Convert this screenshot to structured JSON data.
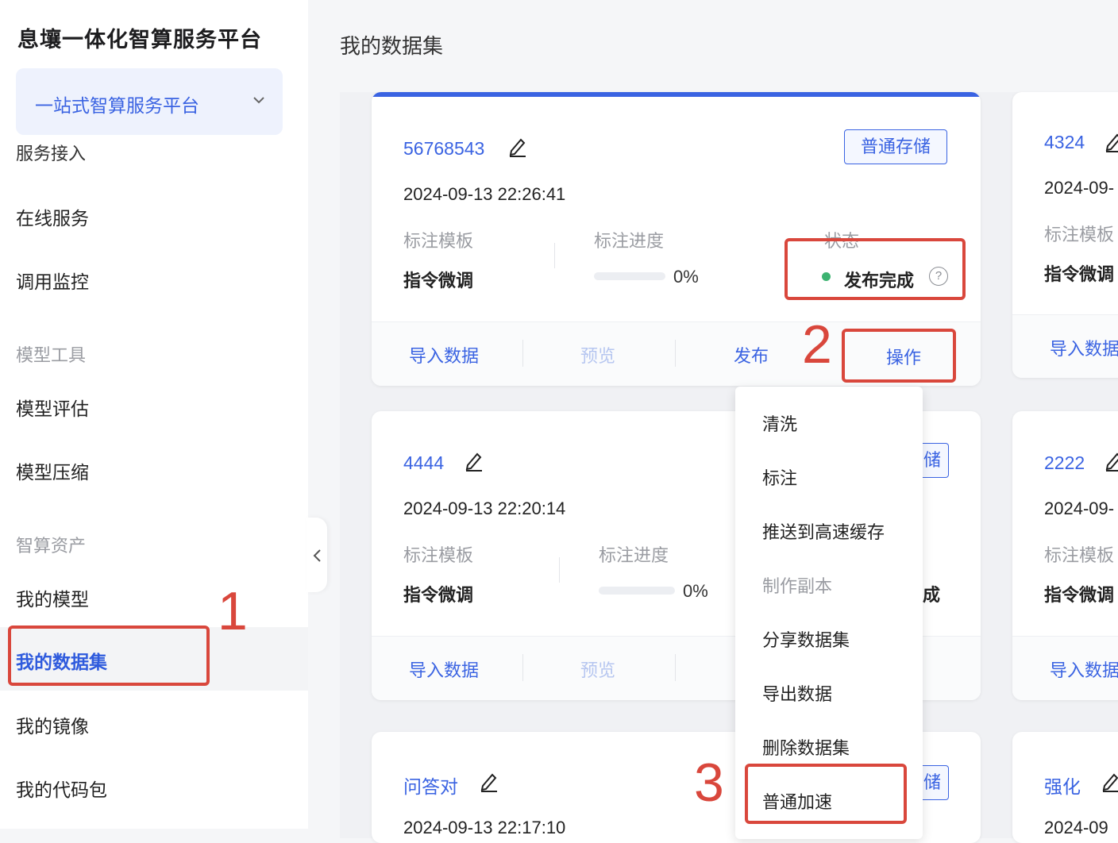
{
  "sidebar": {
    "brand_title": "息壤一体化智算服务平台",
    "platform_selector": "一站式智算服务平台",
    "clipped_item": "服务接入",
    "items": [
      {
        "label": "在线服务"
      },
      {
        "label": "调用监控"
      },
      {
        "label": "模型工具",
        "group": true
      },
      {
        "label": "模型评估"
      },
      {
        "label": "模型压缩"
      },
      {
        "label": "智算资产",
        "group": true
      },
      {
        "label": "我的模型"
      },
      {
        "label": "我的数据集",
        "active": true
      },
      {
        "label": "我的镜像"
      },
      {
        "label": "我的代码包"
      }
    ]
  },
  "page": {
    "title": "我的数据集"
  },
  "cards": [
    {
      "name": "56768543",
      "timestamp": "2024-09-13 22:26:41",
      "storage_tag": "普通存储",
      "template_label": "标注模板",
      "template_value": "指令微调",
      "progress_label": "标注进度",
      "progress_value": "0%",
      "progress_fraction": 0,
      "status_label": "状态",
      "status_value": "发布完成",
      "status_help": "?",
      "actions": [
        "导入数据",
        "预览",
        "发布",
        "操作"
      ]
    },
    {
      "name": "4444",
      "timestamp": "2024-09-13 22:20:14",
      "storage_tag_partial": "储",
      "template_label": "标注模板",
      "template_value": "指令微调",
      "progress_label": "标注进度",
      "progress_value": "0%",
      "progress_fraction": 0,
      "status_partial": "成",
      "actions": [
        "导入数据",
        "预览"
      ]
    },
    {
      "name": "问答对",
      "timestamp": "2024-09-13 22:17:10",
      "storage_tag_partial": "储"
    }
  ],
  "right_cards": [
    {
      "name": "4324",
      "timestamp": "2024-09-",
      "template_label": "标注模板",
      "template_value": "指令微调",
      "action": "导入数据"
    },
    {
      "name": "2222",
      "timestamp": "2024-09-",
      "template_label": "标注模板",
      "template_value": "指令微调",
      "action": "导入数据"
    },
    {
      "name": "强化",
      "timestamp": "2024-09"
    }
  ],
  "dropdown": {
    "items": [
      {
        "label": "清洗"
      },
      {
        "label": "标注"
      },
      {
        "label": "推送到高速缓存"
      },
      {
        "label": "制作副本",
        "disabled": true
      },
      {
        "label": "分享数据集"
      },
      {
        "label": "导出数据"
      },
      {
        "label": "删除数据集"
      },
      {
        "label": "普通加速"
      }
    ]
  },
  "annotations": {
    "step1": "1",
    "step2": "2",
    "step3": "3"
  },
  "colors": {
    "accent": "#3a63e2",
    "annotation": "#d9473c",
    "status_ok": "#3cb371"
  }
}
